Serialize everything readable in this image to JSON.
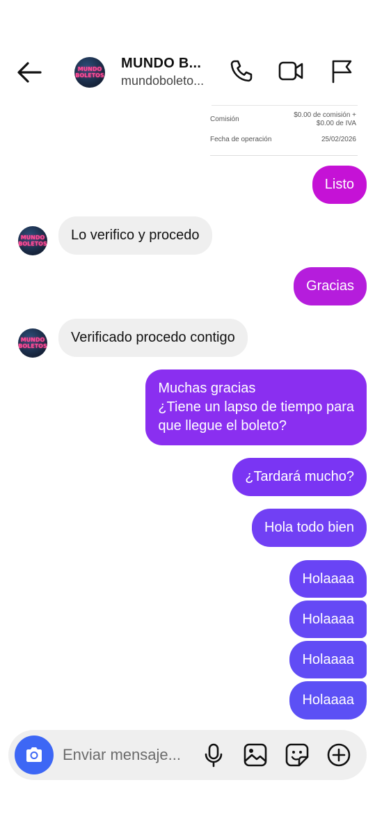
{
  "header": {
    "name": "MUNDO B...",
    "username": "mundoboleto...",
    "avatar_text": "MUNDO BOLETOS"
  },
  "receipt": {
    "commission_label": "Comisión",
    "commission_value_line1": "$0.00 de comisión +",
    "commission_value_line2": "$0.00 de IVA",
    "date_label": "Fecha de operación",
    "date_value": "25/02/2026"
  },
  "messages": [
    {
      "side": "out",
      "text": "Listo",
      "color": "#c512d6"
    },
    {
      "side": "in",
      "text": "Lo verifico y procedo"
    },
    {
      "side": "out",
      "text": "Gracias",
      "color": "#b51ddc"
    },
    {
      "side": "in",
      "text": "Verificado procedo contigo"
    },
    {
      "side": "out",
      "text": "Muchas gracias\n¿Tiene un lapso de tiempo para\nque llegue el boleto?",
      "color": "#8a2ff0"
    },
    {
      "side": "out",
      "text": "¿Tardará mucho?",
      "color": "#7a35f3"
    },
    {
      "side": "out",
      "text": "Hola todo bien",
      "color": "#7140f4"
    },
    {
      "side": "out",
      "text": "Holaaaa",
      "color": "#6944f5"
    },
    {
      "side": "out",
      "text": "Holaaaa",
      "color": "#6549f5"
    },
    {
      "side": "out",
      "text": "Holaaaa",
      "color": "#614cf5"
    },
    {
      "side": "out",
      "text": "Holaaaa",
      "color": "#5c50f5"
    }
  ],
  "composer": {
    "placeholder": "Enviar mensaje...",
    "icons": [
      "camera-icon",
      "microphone-icon",
      "gallery-icon",
      "sticker-icon",
      "add-icon"
    ]
  },
  "header_icons": [
    "back-arrow-icon",
    "phone-icon",
    "video-call-icon",
    "flag-icon"
  ],
  "colors": {
    "incoming_bubble": "#efefef",
    "camera_button": "#3d67f5"
  }
}
